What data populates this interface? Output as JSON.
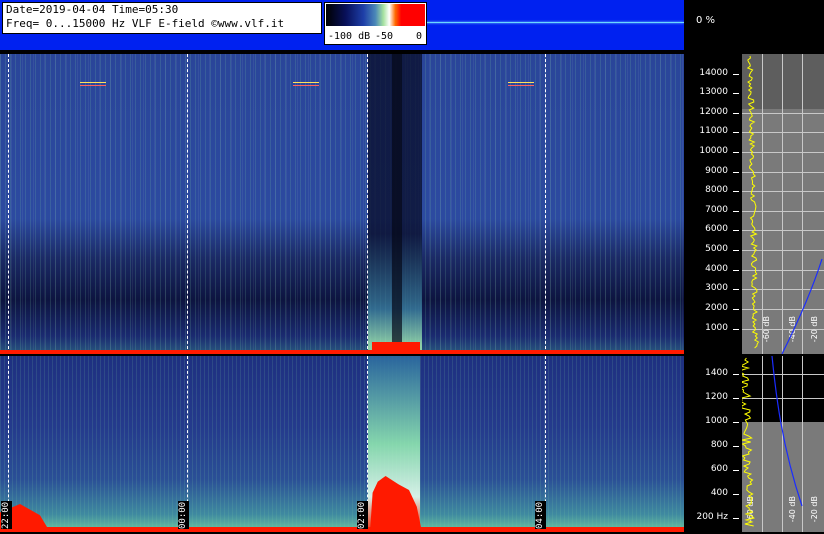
{
  "header": {
    "date_line": "Date=2019-04-04 Time=05:30",
    "freq_line": "Freq= 0...15000 Hz   VLF E-field ©www.vlf.it",
    "colorbar_labels": [
      "-100 dB",
      "-50",
      "0"
    ],
    "percent": "0 %"
  },
  "top_axis": {
    "ticks": [
      {
        "label": "14000",
        "value": 14000
      },
      {
        "label": "13000",
        "value": 13000
      },
      {
        "label": "12000",
        "value": 12000
      },
      {
        "label": "11000",
        "value": 11000
      },
      {
        "label": "10000",
        "value": 10000
      },
      {
        "label": "9000",
        "value": 9000
      },
      {
        "label": "8000",
        "value": 8000
      },
      {
        "label": "7000",
        "value": 7000
      },
      {
        "label": "6000",
        "value": 6000
      },
      {
        "label": "5000",
        "value": 5000
      },
      {
        "label": "4000",
        "value": 4000
      },
      {
        "label": "3000",
        "value": 3000
      },
      {
        "label": "2000",
        "value": 2000
      },
      {
        "label": "1000",
        "value": 1000
      }
    ],
    "db_labels": [
      "-60 dB",
      "-40 dB",
      "-20 dB"
    ]
  },
  "bottom_axis": {
    "ticks": [
      {
        "label": "1400",
        "value": 1400
      },
      {
        "label": "1200",
        "value": 1200
      },
      {
        "label": "1000",
        "value": 1000
      },
      {
        "label": "800",
        "value": 800
      },
      {
        "label": "600",
        "value": 600
      },
      {
        "label": "400",
        "value": 400
      },
      {
        "label": "200 Hz",
        "value": 200
      }
    ],
    "db_labels": [
      "-60 dB",
      "-40 dB",
      "-20 dB"
    ]
  },
  "time_labels": [
    "22:00",
    "00:00",
    "02:00",
    "04:00"
  ],
  "colors": {
    "header_bg": "#0021f0",
    "floor": "#ff1a00",
    "profile": "#ffff00",
    "curve": "#1a2cff"
  }
}
